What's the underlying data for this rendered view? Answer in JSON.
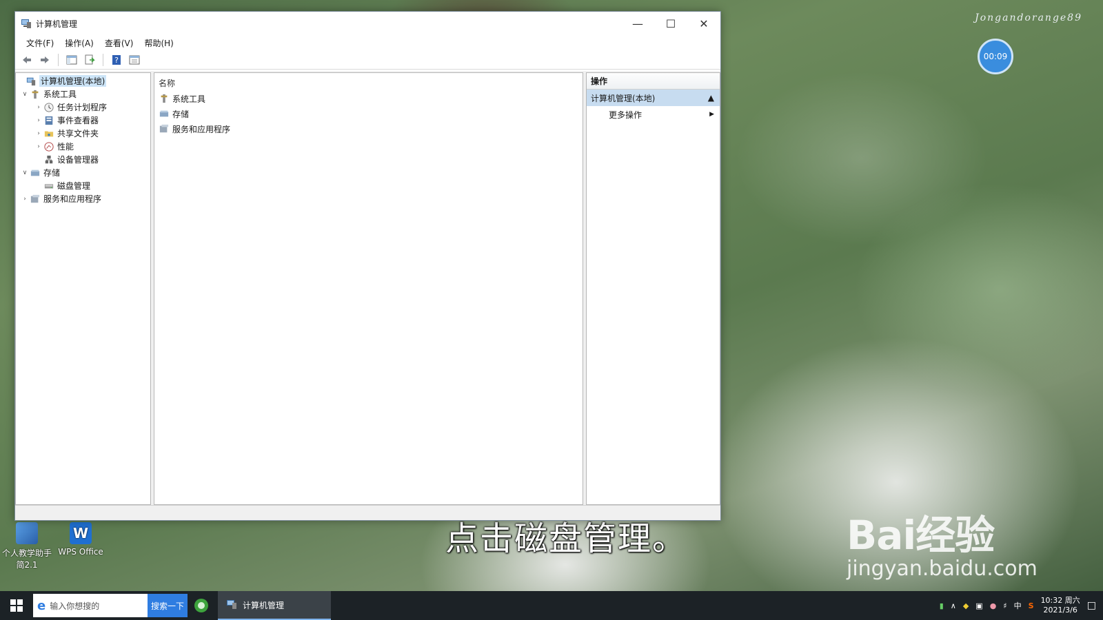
{
  "desktop": {
    "watermark_top": "Jongandorange89",
    "timer": "00:09",
    "subtitle": "点击磁盘管理。",
    "baidu_logo": "Bai经验",
    "baidu_url": "jingyan.baidu.com",
    "icons": [
      {
        "label": "个人教学助手",
        "label2": "简2.1"
      },
      {
        "label": "WPS Office"
      }
    ]
  },
  "window": {
    "title": "计算机管理",
    "menu": [
      "文件(F)",
      "操作(A)",
      "查看(V)",
      "帮助(H)"
    ]
  },
  "tree": {
    "root": "计算机管理(本地)",
    "system_tools": "系统工具",
    "task_scheduler": "任务计划程序",
    "event_viewer": "事件查看器",
    "shared_folders": "共享文件夹",
    "performance": "性能",
    "device_manager": "设备管理器",
    "storage": "存储",
    "disk_management": "磁盘管理",
    "services_apps": "服务和应用程序"
  },
  "center": {
    "col_name": "名称",
    "rows": [
      "系统工具",
      "存储",
      "服务和应用程序"
    ]
  },
  "actions": {
    "header": "操作",
    "section": "计算机管理(本地)",
    "more": "更多操作"
  },
  "taskbar": {
    "search_placeholder": "输入你想搜的",
    "search_button": "搜索一下",
    "task_label": "计算机管理",
    "ime": "中",
    "time": "10:32 周六",
    "date": "2021/3/6"
  },
  "colors": {
    "selection": "#cce4f7",
    "accent": "#2f7de1",
    "taskbar": "#1c2226"
  }
}
